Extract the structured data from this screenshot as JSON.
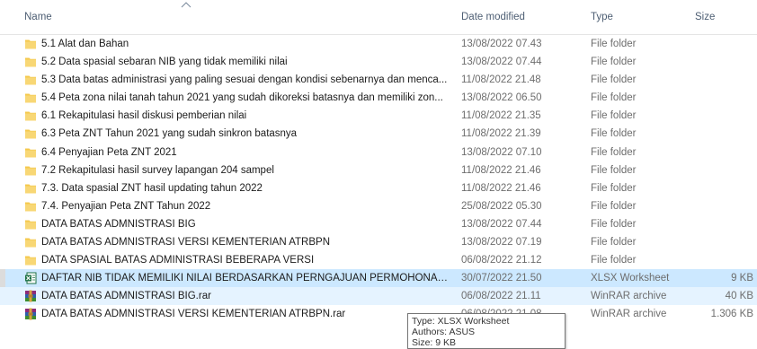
{
  "columns": {
    "name": "Name",
    "date_modified": "Date modified",
    "type": "Type",
    "size": "Size"
  },
  "icons": {
    "folder": "folder-icon",
    "xlsx": "excel-file-icon",
    "rar": "winrar-archive-icon"
  },
  "colors": {
    "folder": "#f5c84c",
    "selected_row": "#cce8ff",
    "hover_row": "#e5f3ff"
  },
  "files": [
    {
      "name": "5.1 Alat dan Bahan",
      "date": "13/08/2022 07.43",
      "type": "File folder",
      "size": "",
      "icon": "folder"
    },
    {
      "name": "5.2 Data spasial sebaran NIB yang tidak memiliki nilai",
      "date": "13/08/2022 07.44",
      "type": "File folder",
      "size": "",
      "icon": "folder"
    },
    {
      "name": "5.3 Data batas administrasi yang paling sesuai dengan kondisi sebenarnya dan menca...",
      "date": "11/08/2022 21.48",
      "type": "File folder",
      "size": "",
      "icon": "folder"
    },
    {
      "name": "5.4 Peta zona nilai tanah tahun 2021 yang sudah dikoreksi batasnya dan memiliki zon...",
      "date": "13/08/2022 06.50",
      "type": "File folder",
      "size": "",
      "icon": "folder"
    },
    {
      "name": "6.1 Rekapitulasi hasil diskusi pemberian nilai",
      "date": "11/08/2022 21.35",
      "type": "File folder",
      "size": "",
      "icon": "folder"
    },
    {
      "name": "6.3 Peta ZNT Tahun 2021 yang sudah sinkron batasnya",
      "date": "11/08/2022 21.39",
      "type": "File folder",
      "size": "",
      "icon": "folder"
    },
    {
      "name": "6.4 Penyajian Peta ZNT 2021",
      "date": "13/08/2022 07.10",
      "type": "File folder",
      "size": "",
      "icon": "folder"
    },
    {
      "name": "7.2 Rekapitulasi hasil survey lapangan 204 sampel",
      "date": "11/08/2022 21.46",
      "type": "File folder",
      "size": "",
      "icon": "folder"
    },
    {
      "name": "7.3. Data spasial ZNT hasil updating tahun 2022",
      "date": "11/08/2022 21.46",
      "type": "File folder",
      "size": "",
      "icon": "folder"
    },
    {
      "name": "7.4. Penyajian Peta ZNT Tahun 2022",
      "date": "25/08/2022 05.30",
      "type": "File folder",
      "size": "",
      "icon": "folder"
    },
    {
      "name": "DATA BATAS ADMNISTRASI BIG",
      "date": "13/08/2022 07.44",
      "type": "File folder",
      "size": "",
      "icon": "folder"
    },
    {
      "name": "DATA BATAS ADMNISTRASI VERSI KEMENTERIAN ATRBPN",
      "date": "13/08/2022 07.19",
      "type": "File folder",
      "size": "",
      "icon": "folder"
    },
    {
      "name": "DATA SPASIAL BATAS ADMINISTRASI BEBERAPA VERSI",
      "date": "06/08/2022 21.12",
      "type": "File folder",
      "size": "",
      "icon": "folder"
    },
    {
      "name": "DAFTAR NIB TIDAK MEMILIKI NILAI BERDASARKAN PERNGAJUAN PERMOHONAN.xlsx",
      "date": "30/07/2022 21.50",
      "type": "XLSX Worksheet",
      "size": "9 KB",
      "icon": "xlsx",
      "state": "selected"
    },
    {
      "name": "DATA BATAS ADMNISTRASI BIG.rar",
      "date": "06/08/2022 21.11",
      "type": "WinRAR archive",
      "size": "40 KB",
      "icon": "rar",
      "state": "hover"
    },
    {
      "name": "DATA BATAS ADMNISTRASI VERSI KEMENTERIAN ATRBPN.rar",
      "date": "06/08/2022 21.08",
      "type": "WinRAR archive",
      "size": "1.306 KB",
      "icon": "rar"
    }
  ],
  "tooltip": {
    "line1": "Type: XLSX Worksheet",
    "line2": "Authors: ASUS",
    "line3": "Size: 9 KB"
  }
}
